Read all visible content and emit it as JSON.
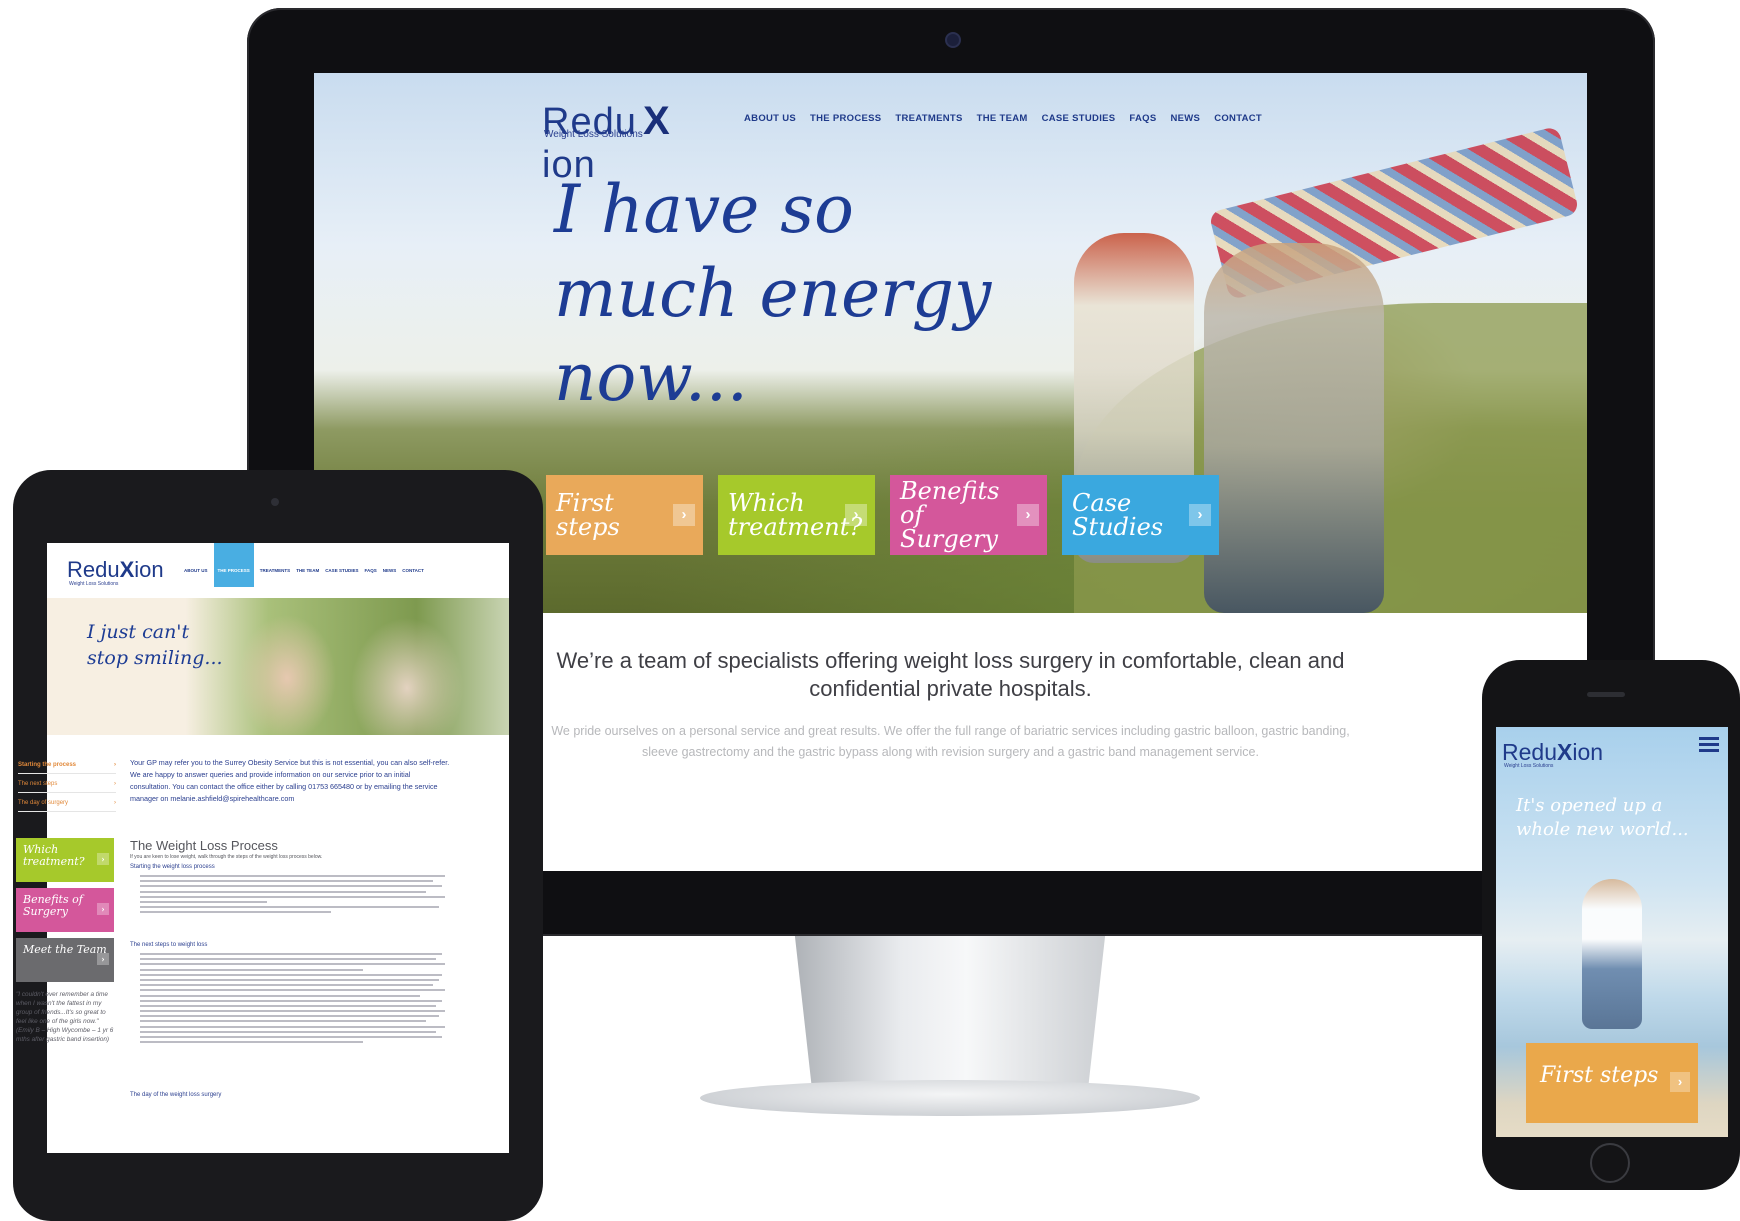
{
  "brand": {
    "name_part1": "Redu",
    "name_x": "X",
    "name_part2": "ion",
    "tagline": "Weight Loss Solutions"
  },
  "desktop": {
    "nav": [
      "ABOUT US",
      "THE PROCESS",
      "TREATMENTS",
      "THE TEAM",
      "CASE STUDIES",
      "FAQS",
      "NEWS",
      "CONTACT"
    ],
    "headline": "I have so much energy now...",
    "tiles": [
      {
        "label": "First steps",
        "color": "#e9a95a"
      },
      {
        "label": "Which treatment?",
        "color": "#a6c92b"
      },
      {
        "label": "Benefits of Surgery",
        "color": "#d4579b"
      },
      {
        "label": "Case Studies",
        "color": "#3aa8df"
      }
    ],
    "lead_title": "We’re a team of specialists offering weight loss surgery in comfortable, clean and confidential private hospitals.",
    "lead_body": "We pride ourselves on a personal service and great results. We offer the full range of bariatric services including gastric balloon, gastric banding,  sleeve gastrectomy and the gastric bypass along with revision surgery and a gastric band management service."
  },
  "tablet": {
    "nav": [
      "ABOUT US",
      "THE PROCESS",
      "TREATMENTS",
      "THE TEAM",
      "CASE STUDIES",
      "FAQS",
      "NEWS",
      "CONTACT"
    ],
    "nav_active": "THE PROCESS",
    "hero_text": "I just can't stop smiling...",
    "side_links": [
      "Starting the process",
      "The next steps",
      "The day of surgery"
    ],
    "side_tiles": [
      {
        "label": "Which treatment?",
        "color": "#a6c92b"
      },
      {
        "label": "Benefits of Surgery",
        "color": "#d4579b"
      },
      {
        "label": "Meet the Team",
        "color": "#6b6b6e"
      }
    ],
    "quote": "\"I couldn't ever remember a time when I wasn't the fattest in my group of friends...It's so great to feel like one of the girls now.\" (Emily B – High Wycombe – 1 yr 6 mths after gastric band insertion)",
    "intro": "Your GP may refer you to the Surrey Obesity Service but this is not essential, you can also self-refer. We are happy to answer queries and provide information on our service prior to an initial consultation. You can contact the office either by calling 01753 665480 or by emailing the service manager on melanie.ashfield@spirehealthcare.com",
    "content_title": "The Weight Loss Process",
    "content_sub": "If you are keen to lose weight, walk through the steps of the weight loss process below.",
    "heading_1": "Starting the weight loss process",
    "heading_2": "The next steps to weight loss",
    "heading_3": "The day of the weight loss surgery"
  },
  "phone": {
    "headline": "It's opened up a whole new world...",
    "tile": {
      "label": "First steps",
      "color": "#eaa84b"
    }
  }
}
